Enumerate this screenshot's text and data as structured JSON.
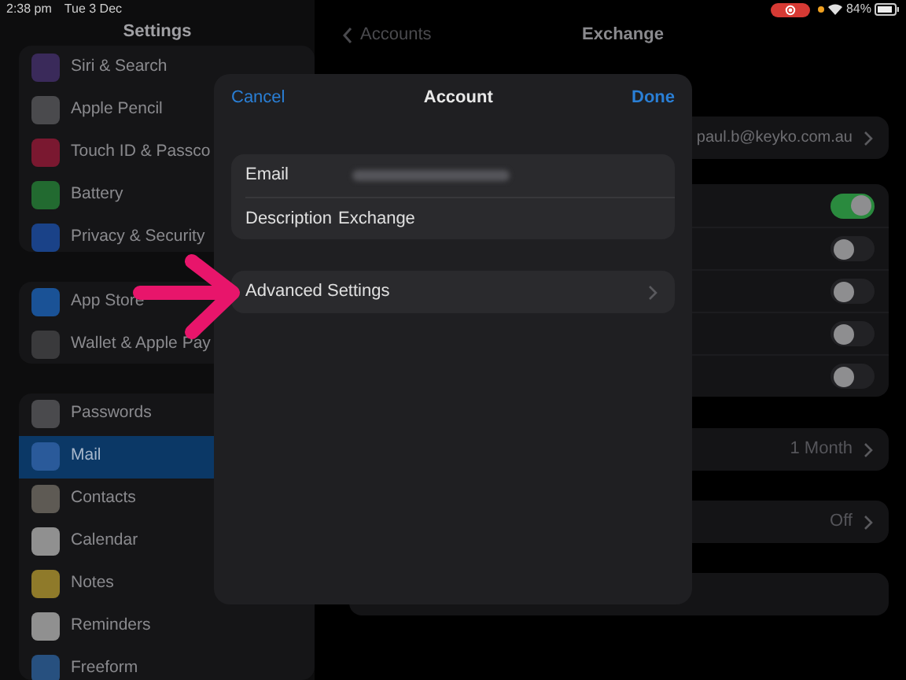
{
  "status_bar": {
    "time": "2:38 pm",
    "date": "Tue 3 Dec",
    "battery_text": "84%"
  },
  "sidebar": {
    "title": "Settings",
    "groups": [
      [
        {
          "label": "Siri & Search",
          "color": "#3a2a5a",
          "selected": false
        },
        {
          "label": "Apple Pencil",
          "color": "#4a4a4d",
          "selected": false
        },
        {
          "label": "Touch ID & Passco",
          "color": "#7a1830",
          "selected": false
        },
        {
          "label": "Battery",
          "color": "#226a30",
          "selected": false
        },
        {
          "label": "Privacy & Security",
          "color": "#1a4288",
          "selected": false
        }
      ],
      [
        {
          "label": "App Store",
          "color": "#1a5296",
          "selected": false
        },
        {
          "label": "Wallet & Apple Pay",
          "color": "#3a3a3c",
          "selected": false
        }
      ],
      [
        {
          "label": "Passwords",
          "color": "#4a4a4d",
          "selected": false
        },
        {
          "label": "Mail",
          "color": "#2a5a9a",
          "selected": true
        },
        {
          "label": "Contacts",
          "color": "#5e5a54",
          "selected": false
        },
        {
          "label": "Calendar",
          "color": "#909090",
          "selected": false
        },
        {
          "label": "Notes",
          "color": "#8f7a2a",
          "selected": false
        },
        {
          "label": "Reminders",
          "color": "#909090",
          "selected": false
        },
        {
          "label": "Freeform",
          "color": "#27507f",
          "selected": false
        }
      ]
    ]
  },
  "detail": {
    "back_label": "Accounts",
    "title": "Exchange",
    "account_value": "paul.b@keyko.com.au",
    "toggles": [
      {
        "on": true
      },
      {
        "on": false
      },
      {
        "on": false
      },
      {
        "on": false
      },
      {
        "on": false
      }
    ],
    "rows": [
      {
        "value": "1 Month"
      },
      {
        "value": "Off"
      }
    ]
  },
  "modal": {
    "cancel": "Cancel",
    "title": "Account",
    "done": "Done",
    "fields": [
      {
        "label": "Email",
        "redacted": true
      },
      {
        "label": "Description",
        "value": "Exchange",
        "redacted": false
      }
    ],
    "advanced_label": "Advanced Settings"
  }
}
